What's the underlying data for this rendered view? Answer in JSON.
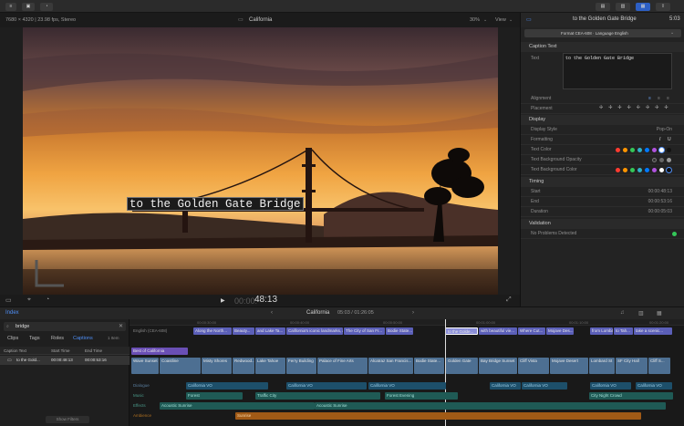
{
  "window": {
    "title": "California"
  },
  "viewer": {
    "format_info": "7680 × 4320 | 23.98 fps, Stereo",
    "project_name": "California",
    "zoom": "30%",
    "view_menu": "View",
    "caption_text": "to the Golden Gate Bridge",
    "timecode": "48:13",
    "timecode_dim": "00:00:"
  },
  "inspector": {
    "clip_title": "to the Golden Gate Bridge",
    "clip_duration": "5:03",
    "format_selector": "Format CEA-608 · Language English",
    "sections": {
      "caption_text": "Caption Text",
      "display": "Display",
      "timing": "Timing",
      "validation": "Validation"
    },
    "fields": {
      "text_label": "Text",
      "text_value": "to the Golden Gate Bridge",
      "alignment": "Alignment",
      "placement": "Placement",
      "display_style": "Display Style",
      "display_style_value": "Pop-On",
      "formatting": "Formatting",
      "text_color": "Text Color",
      "bg_opacity": "Text Background Opacity",
      "bg_color": "Text Background Color",
      "start": "Start",
      "start_value": "00:00:48:13",
      "end": "End",
      "end_value": "00:00:53:16",
      "duration": "Duration",
      "duration_value": "00:00:05:03",
      "validation_value": "No Problems Detected"
    },
    "colors": [
      "#ff3b30",
      "#ff9500",
      "#ffcc00",
      "#34c759",
      "#30b0c7",
      "#007aff",
      "#af52de",
      "#ffffff"
    ]
  },
  "browser": {
    "index_label": "Index",
    "search_value": "bridge",
    "tabs": [
      "Clips",
      "Tags",
      "Roles",
      "Captions"
    ],
    "item_count": "1 Item",
    "columns": [
      "Caption Text",
      "Start Time",
      "End Time"
    ],
    "rows": [
      [
        "to the Gold...",
        "00:00:48:13",
        "00:00:53:16"
      ]
    ],
    "footer_button": "Show Filters"
  },
  "timeline": {
    "project": "California",
    "position": "05:03 / 01:26:05",
    "ruler": [
      "00:00:30:00",
      "00:00:40:00",
      "00:00:50:00",
      "00:01:00:00",
      "00:01:10:00",
      "00:01:20:00"
    ],
    "caption_lane_label": "English (CEA-608)",
    "captions": [
      "Along the North...",
      "Beauty...",
      "and Lake Ta...",
      "California's iconic landmarks, are sure...",
      "The City of San Fr...",
      "Bodie State...",
      "to the Golde...",
      "with beautiful vie...",
      "Where Cut...",
      "Mojave Des...",
      "from Lombar...",
      "to Tah...",
      "take a scenic..."
    ],
    "title_clip": "Best of California",
    "video_clips": [
      "Wave Sunset",
      "Coastline",
      "Misty Shores",
      "Redwood...",
      "Lake Tahoe",
      "Ferry Building",
      "Palace of Fine Arts",
      "Alcatraz San Francis...",
      "Bodie State...",
      "Golden Gate",
      "Bay Bridge Sunset",
      "Cliff Vista",
      "Mojave Desert",
      "Lombard St",
      "SF City Hall",
      "Cliff S..."
    ],
    "role_labels": [
      "Dialogue",
      "Music",
      "Effects",
      "Ambience"
    ],
    "dialogue_clips": [
      "California VO",
      "California VO",
      "California VO",
      "California VO",
      "California VO",
      "California VO",
      "California VO"
    ],
    "music_clips": [
      "Forest",
      "Traffic City",
      "Forest Evening",
      "City Night Crowd"
    ],
    "effects_clips": [
      "Acoustic Sunrise",
      "Acoustic Sunrise"
    ],
    "ambience_clip": "Sunrise"
  }
}
